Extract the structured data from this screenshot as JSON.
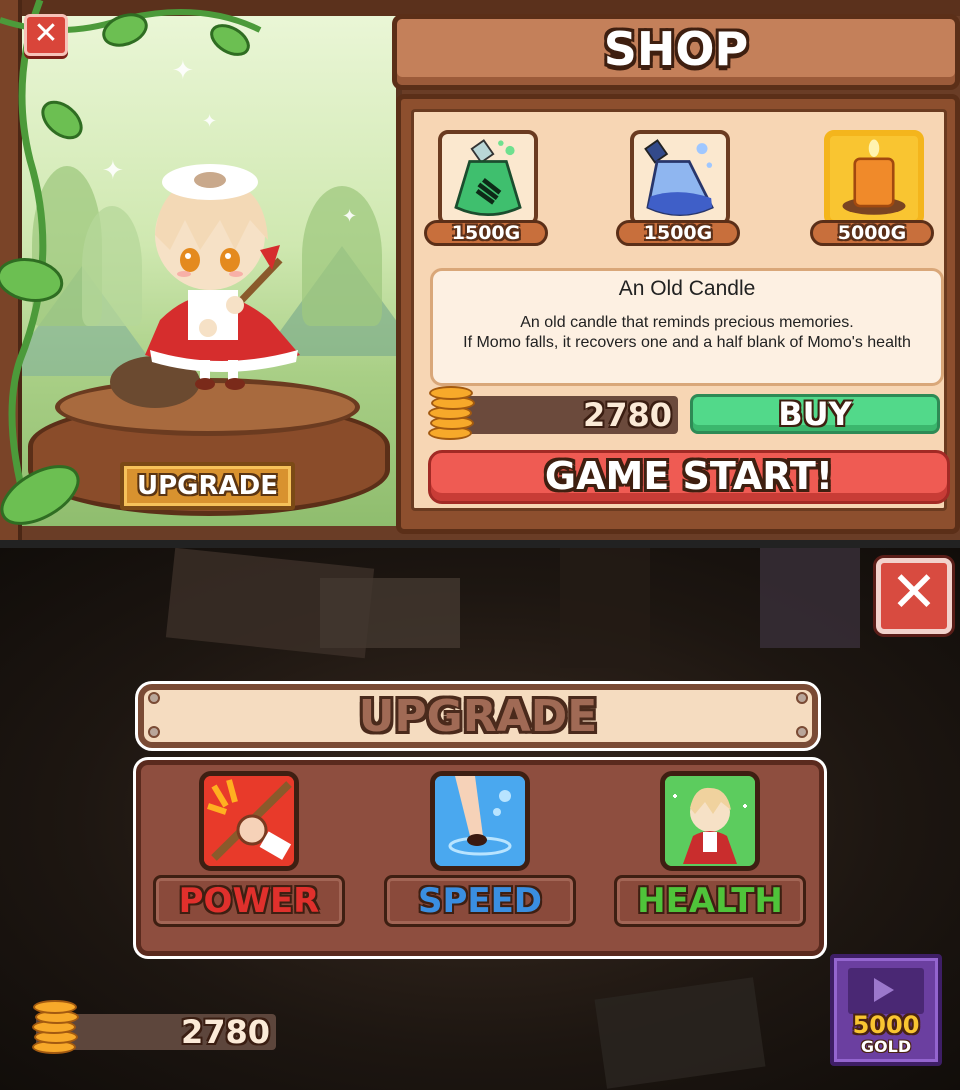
{
  "shop_screen": {
    "close_icon": "close-icon",
    "upgrade_button_label": "UPGRADE",
    "title": "SHOP",
    "items": [
      {
        "icon": "green-potion-icon",
        "price": "1500G",
        "selected": false
      },
      {
        "icon": "blue-potion-icon",
        "price": "1500G",
        "selected": false
      },
      {
        "icon": "candle-icon",
        "price": "5000G",
        "selected": true
      }
    ],
    "selected_item": {
      "name": "An Old Candle",
      "description_line1": "An old candle that reminds precious memories.",
      "description_line2": "If Momo falls, it recovers one and a half blank of Momo's health"
    },
    "gold": "2780",
    "buy_label": "BUY",
    "game_start_label": "GAME START!"
  },
  "upgrade_screen": {
    "close_icon": "close-icon",
    "title": "UPGRADE",
    "stats": [
      {
        "label": "POWER",
        "icon": "broom-fist-icon",
        "color": "#e0302c"
      },
      {
        "label": "SPEED",
        "icon": "running-feet-icon",
        "color": "#3a8ee0"
      },
      {
        "label": "HEALTH",
        "icon": "character-heal-icon",
        "color": "#4fc43a"
      }
    ],
    "gold": "2780",
    "ad_reward": {
      "amount": "5000",
      "label": "GOLD",
      "icon": "video-play-icon"
    }
  },
  "colors": {
    "wood": "#8d4f2e",
    "panel_cream": "#f7d6b4",
    "buy_green": "#52d98a",
    "start_red": "#ef5b53",
    "close_red": "#d84b40",
    "ad_purple": "#6b3fa0"
  }
}
